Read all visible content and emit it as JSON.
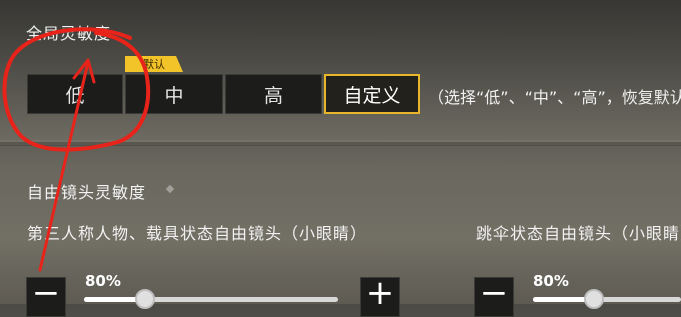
{
  "global_sensitivity": {
    "title": "全局灵敏度",
    "default_tag": "默认",
    "options": [
      "低",
      "中",
      "高",
      "自定义"
    ],
    "selected": "自定义",
    "hint": "（选择“低”、“中”、“高”，恢复默认"
  },
  "free_camera_sensitivity": {
    "title": "自由镜头灵敏度",
    "items": [
      {
        "label": "第三人称人物、载具状态自由镜头（小眼睛）",
        "value_text": "80%",
        "value": 0.8,
        "minus": "−",
        "plus": "+"
      },
      {
        "label": "跳伞状态自由镜头（小眼睛）",
        "value_text": "80%",
        "value": 0.8,
        "minus": "−"
      }
    ]
  },
  "colors": {
    "accent": "#e9b52a",
    "annotation": "#e8231a"
  }
}
